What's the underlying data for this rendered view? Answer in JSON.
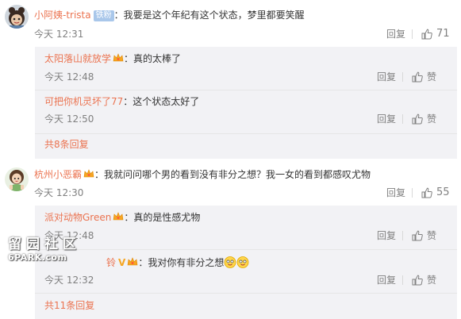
{
  "comment1": {
    "user": "小阿姨-trista",
    "badge": "铁粉",
    "text": "：我要是这个年纪有这个状态，梦里都要笑醒",
    "time": "今天 12:31",
    "reply_label": "回复",
    "like_count": "71",
    "replies": [
      {
        "user": "太阳落山就放学",
        "text": "：真的太棒了",
        "time": "今天 12:48",
        "reply_label": "回复",
        "like_label": "赞"
      },
      {
        "user": "可把你机灵坏了77",
        "text": "：这个状态太好了",
        "time": "今天 12:50",
        "reply_label": "回复",
        "like_label": "赞"
      }
    ],
    "more": "共8条回复"
  },
  "comment2": {
    "user": "杭州小恶霸",
    "text": "：我就问问哪个男的看到没有非分之想？我一女的看到都感叹尤物",
    "time": "今天 12:30",
    "reply_label": "回复",
    "like_count": "55",
    "replies": [
      {
        "user": "派对动物Green",
        "text": "：真的是性感尤物",
        "time": "今天 12:48",
        "reply_label": "回复",
        "like_label": "赞"
      },
      {
        "user": "铃",
        "text": "：我对你有非分之想",
        "time": "今天 12:32",
        "reply_label": "回复",
        "like_label": "赞"
      }
    ],
    "more": "共11条回复"
  },
  "watermark": {
    "line1": "留园社区",
    "line2": "6PARK.com"
  },
  "colors": {
    "username": "#eb7350",
    "meta": "#808080",
    "reply_bg": "#f2f2f5",
    "badge": "#a9c7ea"
  },
  "icons": [
    "avatar-cartoon",
    "avatar-girl",
    "vip-crown-icon",
    "thumb-up-icon",
    "emoji-face-icon"
  ]
}
